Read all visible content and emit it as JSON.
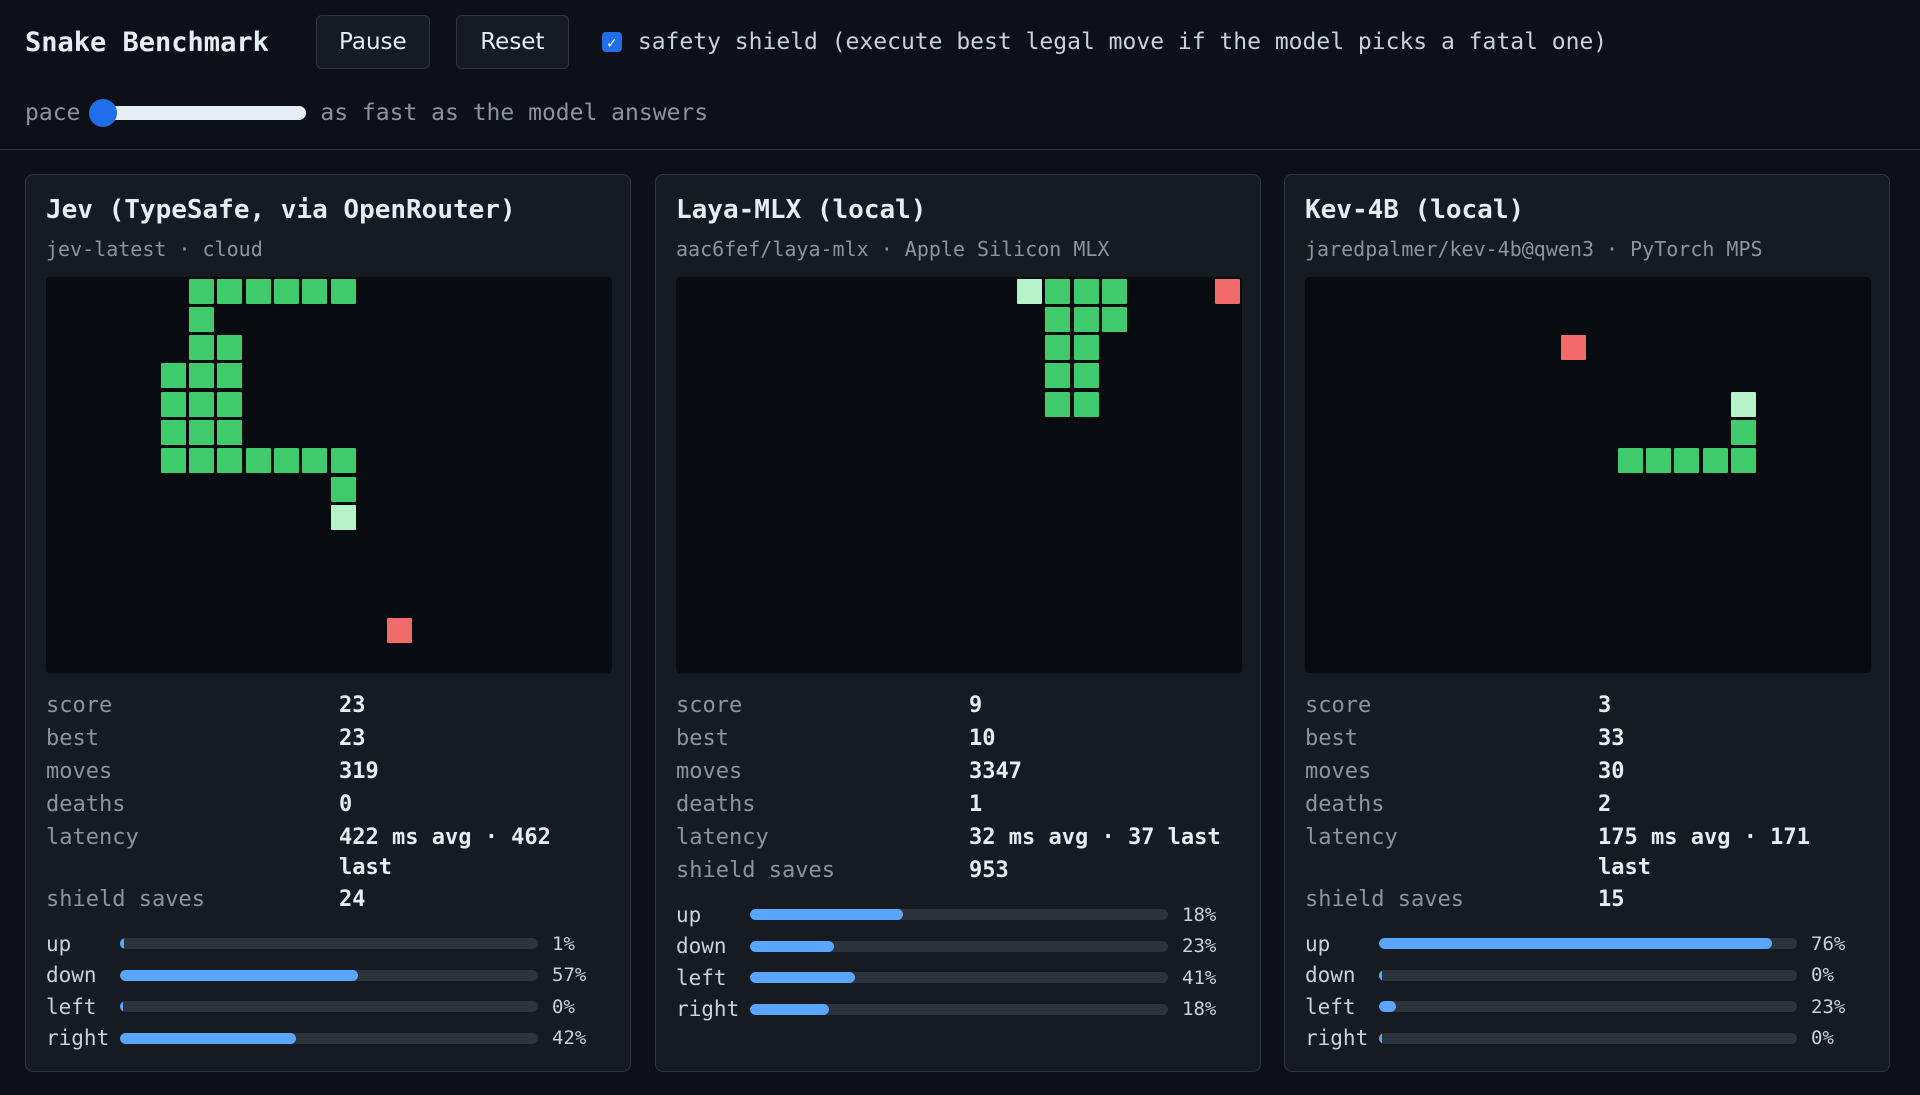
{
  "header": {
    "title": "Snake Benchmark",
    "pause_label": "Pause",
    "reset_label": "Reset",
    "shield_checked": true,
    "shield_label": "safety shield (execute best legal move if the model picks a fatal one)",
    "pace_label": "pace",
    "pace_value": 0,
    "pace_description": "as fast as the model answers"
  },
  "colors": {
    "accent": "#1f6feb",
    "snake_body": "#3fca6b",
    "snake_head": "#b6f3c8",
    "food": "#f26b6b",
    "bar_fill": "#58a6ff"
  },
  "stat_labels": {
    "score": "score",
    "best": "best",
    "moves": "moves",
    "deaths": "deaths",
    "latency": "latency",
    "shield_saves": "shield saves"
  },
  "panels": [
    {
      "title": "Jev (TypeSafe, via OpenRouter)",
      "subtitle": "jev-latest · cloud",
      "board": {
        "grid_cols": 20,
        "grid_rows": 14,
        "body": [
          [
            5,
            0
          ],
          [
            6,
            0
          ],
          [
            7,
            0
          ],
          [
            8,
            0
          ],
          [
            9,
            0
          ],
          [
            10,
            0
          ],
          [
            5,
            1
          ],
          [
            5,
            2
          ],
          [
            6,
            2
          ],
          [
            4,
            3
          ],
          [
            5,
            3
          ],
          [
            6,
            3
          ],
          [
            4,
            4
          ],
          [
            5,
            4
          ],
          [
            6,
            4
          ],
          [
            4,
            5
          ],
          [
            5,
            5
          ],
          [
            6,
            5
          ],
          [
            4,
            6
          ],
          [
            5,
            6
          ],
          [
            6,
            6
          ],
          [
            7,
            6
          ],
          [
            8,
            6
          ],
          [
            9,
            6
          ],
          [
            10,
            6
          ],
          [
            10,
            7
          ]
        ],
        "head": [
          10,
          8
        ],
        "food": [
          12,
          12
        ]
      },
      "stats": {
        "score": "23",
        "best": "23",
        "moves": "319",
        "deaths": "0",
        "latency": "422 ms avg · 462 last",
        "shield_saves": "24"
      },
      "moves_dist": [
        {
          "dir": "up",
          "pct": "1%",
          "value": 1
        },
        {
          "dir": "down",
          "pct": "57%",
          "value": 57
        },
        {
          "dir": "left",
          "pct": "0%",
          "value": 0
        },
        {
          "dir": "right",
          "pct": "42%",
          "value": 42
        }
      ]
    },
    {
      "title": "Laya-MLX (local)",
      "subtitle": "aac6fef/laya-mlx · Apple Silicon MLX",
      "board": {
        "grid_cols": 20,
        "grid_rows": 14,
        "body": [
          [
            13,
            0
          ],
          [
            14,
            0
          ],
          [
            15,
            0
          ],
          [
            13,
            1
          ],
          [
            14,
            1
          ],
          [
            15,
            1
          ],
          [
            13,
            2
          ],
          [
            14,
            2
          ],
          [
            13,
            3
          ],
          [
            14,
            3
          ],
          [
            13,
            4
          ],
          [
            14,
            4
          ]
        ],
        "head": [
          12,
          0
        ],
        "food": [
          19,
          0
        ]
      },
      "stats": {
        "score": "9",
        "best": "10",
        "moves": "3347",
        "deaths": "1",
        "latency": "32 ms avg · 37 last",
        "shield_saves": "953"
      },
      "moves_dist": [
        {
          "dir": "up",
          "pct": "18%",
          "value": 36.5
        },
        {
          "dir": "down",
          "pct": "23%",
          "value": 20
        },
        {
          "dir": "left",
          "pct": "41%",
          "value": 25
        },
        {
          "dir": "right",
          "pct": "18%",
          "value": 19
        }
      ]
    },
    {
      "title": "Kev-4B (local)",
      "subtitle": "jaredpalmer/kev-4b@qwen3 · PyTorch MPS",
      "board": {
        "grid_cols": 20,
        "grid_rows": 14,
        "body": [
          [
            11,
            6
          ],
          [
            12,
            6
          ],
          [
            13,
            6
          ],
          [
            14,
            6
          ],
          [
            15,
            6
          ],
          [
            15,
            5
          ]
        ],
        "head": [
          15,
          4
        ],
        "food": [
          9,
          2
        ]
      },
      "stats": {
        "score": "3",
        "best": "33",
        "moves": "30",
        "deaths": "2",
        "latency": "175 ms avg · 171 last",
        "shield_saves": "15"
      },
      "moves_dist": [
        {
          "dir": "up",
          "pct": "76%",
          "value": 94
        },
        {
          "dir": "down",
          "pct": "0%",
          "value": 0
        },
        {
          "dir": "left",
          "pct": "23%",
          "value": 4
        },
        {
          "dir": "right",
          "pct": "0%",
          "value": 0
        }
      ]
    }
  ]
}
